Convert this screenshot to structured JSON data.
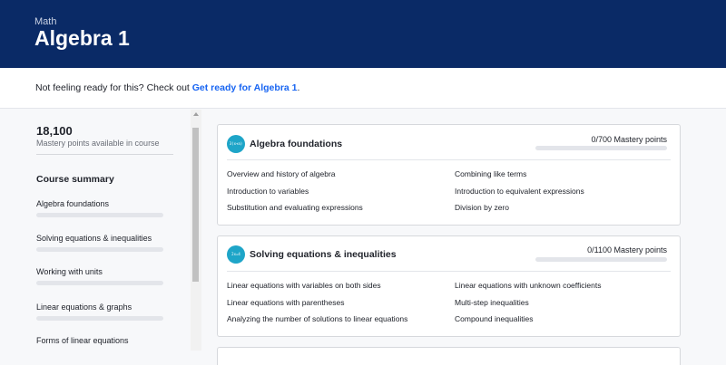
{
  "header": {
    "subject": "Math",
    "title": "Algebra 1"
  },
  "banner": {
    "prefix": "Not feeling ready for this? Check out ",
    "link": "Get ready for Algebra 1",
    "suffix": "."
  },
  "sidebar": {
    "points": "18,100",
    "points_caption": "Mastery points available in course",
    "summary_title": "Course summary",
    "items": [
      {
        "label": "Algebra foundations",
        "progress": 0
      },
      {
        "label": "Solving equations & inequalities",
        "progress": 0
      },
      {
        "label": "Working with units",
        "progress": 0
      },
      {
        "label": "Linear equations & graphs",
        "progress": 0
      },
      {
        "label": "Forms of linear equations",
        "progress": 0
      }
    ]
  },
  "units": [
    {
      "badge": "3(x+a)",
      "title": "Algebra foundations",
      "mastery": "0/700 Mastery points",
      "progress": 0,
      "lessons": [
        "Overview and history of algebra",
        "Combining like terms",
        "Introduction to variables",
        "Introduction to equivalent expressions",
        "Substitution and evaluating expressions",
        "Division by zero"
      ]
    },
    {
      "badge": "2x=4",
      "title": "Solving equations & inequalities",
      "mastery": "0/1100 Mastery points",
      "progress": 0,
      "lessons": [
        "Linear equations with variables on both sides",
        "Linear equations with unknown coefficients",
        "Linear equations with parentheses",
        "Multi-step inequalities",
        "Analyzing the number of solutions to linear equations",
        "Compound inequalities"
      ]
    }
  ],
  "colors": {
    "header_bg": "#0a2a66",
    "link": "#1865f2",
    "badge": "#1ea5c8"
  }
}
